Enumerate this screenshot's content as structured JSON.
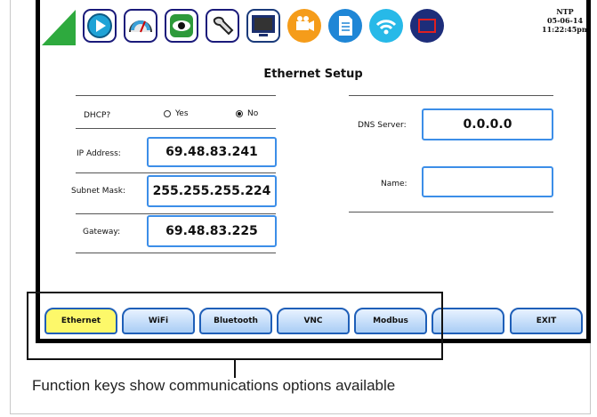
{
  "toolbar": {
    "icons": [
      "play-icon",
      "gauge-icon",
      "eye-icon",
      "wrench-icon",
      "monitor-icon",
      "camera-icon",
      "document-icon",
      "wifi-icon",
      "window-icon"
    ],
    "clock": {
      "sync": "NTP",
      "date": "05-06-14",
      "time": "11:22:45pm"
    }
  },
  "page": {
    "title": "Ethernet Setup"
  },
  "form": {
    "dhcp_label": "DHCP?",
    "dhcp_options": [
      "Yes",
      "No"
    ],
    "dhcp_selected": "No",
    "ip_label": "IP Address:",
    "ip_value": "69.48.83.241",
    "subnet_label": "Subnet Mask:",
    "subnet_value": "255.255.255.224",
    "gateway_label": "Gateway:",
    "gateway_value": "69.48.83.225",
    "dns_label": "DNS Server:",
    "dns_value": "0.0.0.0",
    "name_label": "Name:",
    "name_value": ""
  },
  "function_keys": [
    "Ethernet",
    "WiFi",
    "Bluetooth",
    "VNC",
    "Modbus",
    "",
    "EXIT"
  ],
  "active_key": "Ethernet",
  "caption": "Function keys show communications options available",
  "colors": {
    "accent": "#3c8ee8",
    "active_key": "#fdf86a",
    "logo": "#2eaa3e"
  }
}
